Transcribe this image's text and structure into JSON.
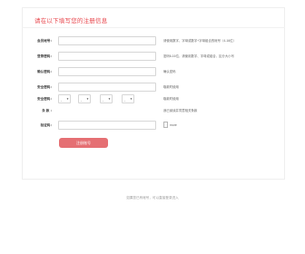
{
  "form": {
    "title": "请在以下填写您的注册信息",
    "fields": {
      "account": {
        "label": "会员帐号：",
        "hint": "请使用数字、字母或数字+字母组合的帐号（4-16位）",
        "value": ""
      },
      "password": {
        "label": "登录密码：",
        "hint": "密码6-16位，请使用数字、字母或组合，区分大小写",
        "value": ""
      },
      "confirm": {
        "label": "确认密码：",
        "hint": "确认密码",
        "value": ""
      },
      "secpass": {
        "label": "安全密码：",
        "hint": "取款时使用",
        "value": ""
      },
      "secpass_selects": {
        "label": "安全密码：",
        "s1": "-",
        "s2": "-",
        "s3": "-",
        "s4": "-",
        "hint": "取款时使用"
      },
      "terms": {
        "label": "条 款 ：",
        "text": "我已阅读并同意相关条款"
      },
      "captcha": {
        "label": "验证码：",
        "value": "",
        "hint": "more"
      }
    },
    "submit_label": "注册账号"
  },
  "footer": {
    "text": "如果您已有帐号，可以直接登录进入"
  }
}
